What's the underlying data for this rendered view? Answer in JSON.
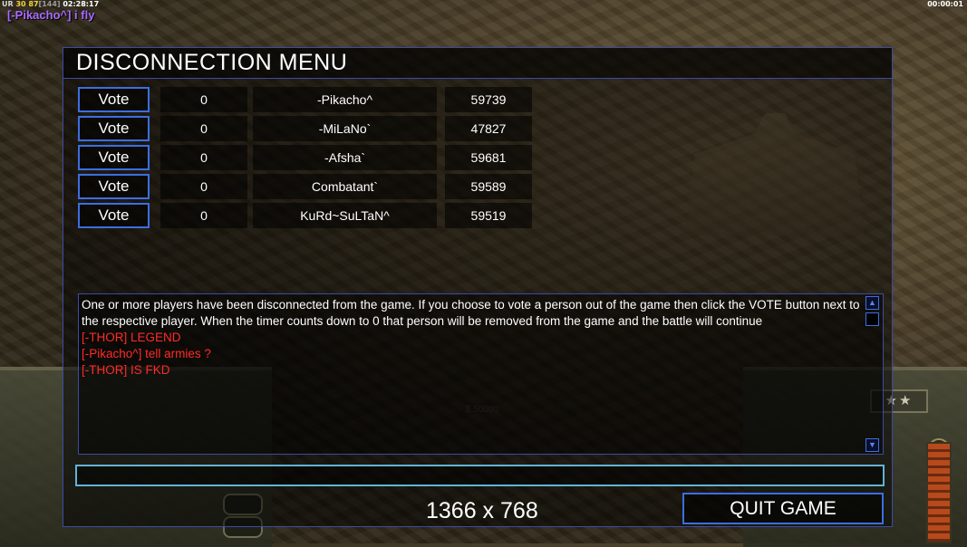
{
  "overlay": {
    "stats": {
      "a": "UR",
      "b": "30",
      "c": "87",
      "d": "[144]",
      "e": "02:28:17"
    },
    "chat_line": "[-Pikacho^] i fly",
    "clock": "00:00:01"
  },
  "hud": {
    "money": "$ 50000",
    "rank_stars": "★★"
  },
  "menu": {
    "title": "DISCONNECTION MENU",
    "vote_label": "Vote",
    "players": [
      {
        "timer": "0",
        "name": "-Pikacho^",
        "ping": "59739"
      },
      {
        "timer": "0",
        "name": "-MiLaNo`",
        "ping": "47827"
      },
      {
        "timer": "0",
        "name": "-Afsha`",
        "ping": "59681"
      },
      {
        "timer": "0",
        "name": "Combatant`",
        "ping": "59589"
      },
      {
        "timer": "0",
        "name": "KuRd~SuLTaN^",
        "ping": "59519"
      }
    ],
    "chat": {
      "system_message": "One or more players have been disconnected from the game. If you choose to vote a person out of the game then click the VOTE button next to the respective player. When the timer counts down to 0 that person will be removed from the game and the battle will continue",
      "messages": [
        "[-THOR] LEGEND",
        "[-Pikacho^] tell armies ?",
        "[-THOR] IS FKD"
      ]
    },
    "input_value": "",
    "resolution": "1366 x 768",
    "quit_label": "QUIT GAME"
  },
  "colors": {
    "accent_blue": "#3b6fe0",
    "input_border": "#5fb4d6",
    "chat_red": "#ff2a2a",
    "overlay_purple": "#a86bff"
  }
}
